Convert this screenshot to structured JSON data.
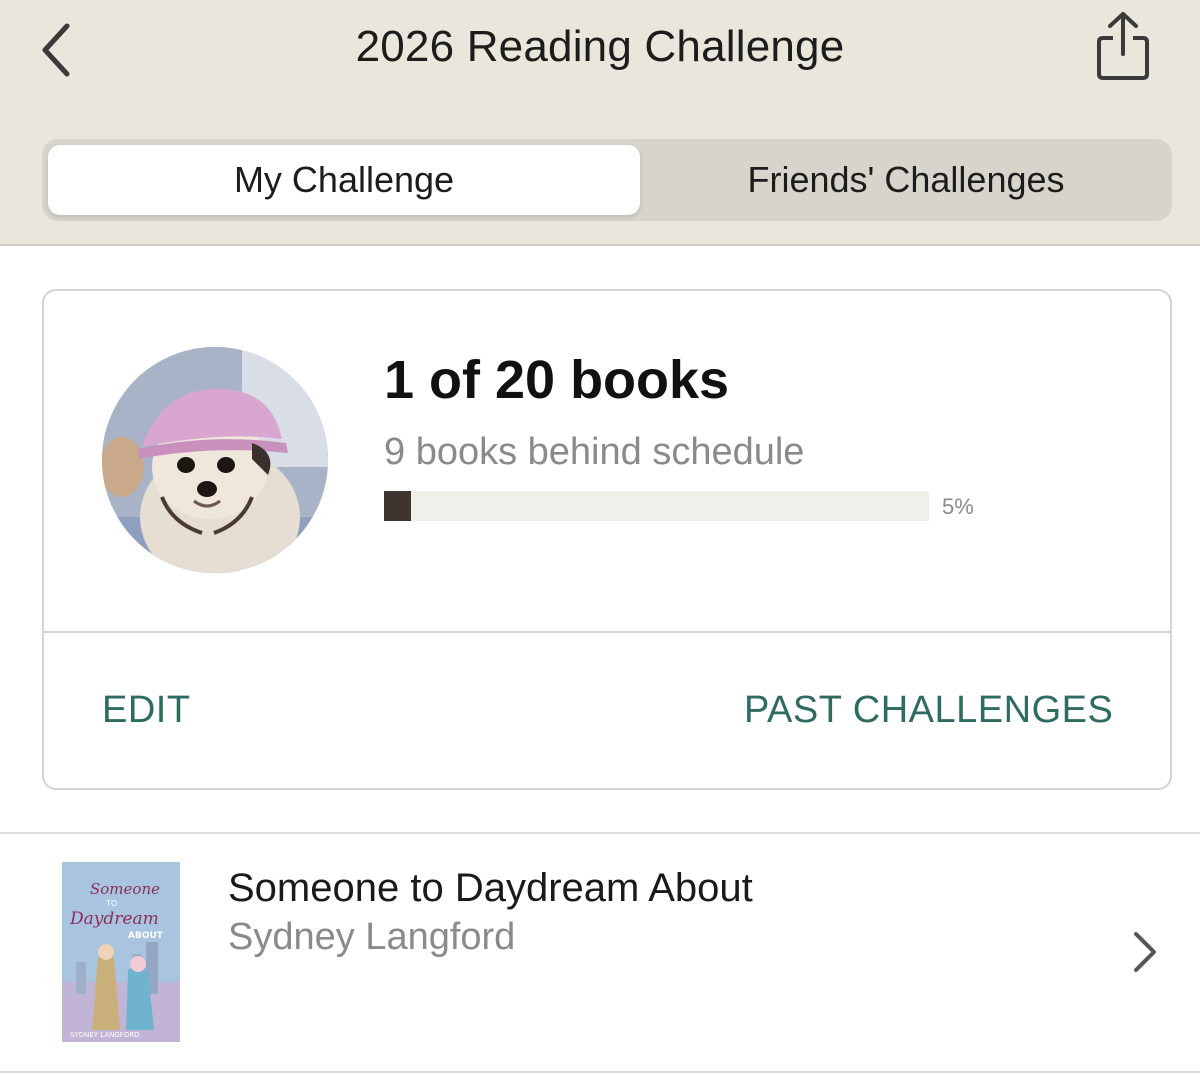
{
  "header": {
    "title": "2026 Reading Challenge",
    "back_icon": "chevron-left-icon",
    "share_icon": "share-icon"
  },
  "tabs": [
    {
      "label": "My Challenge",
      "selected": true
    },
    {
      "label": "Friends' Challenges",
      "selected": false
    }
  ],
  "challenge": {
    "progress_text": "1 of 20 books",
    "status_text": "9 books behind schedule",
    "progress_fraction": 0.05,
    "progress_percent_label": "5%",
    "edit_label": "EDIT",
    "past_label": "PAST CHALLENGES"
  },
  "books": [
    {
      "title": "Someone to Daydream About",
      "author": "Sydney Langford",
      "cover_title_1": "Someone",
      "cover_title_2": "TO",
      "cover_title_3": "Daydream",
      "cover_title_4": "ABOUT",
      "cover_author": "SYDNEY LANGFORD"
    }
  ],
  "colors": {
    "header_bg": "#e9e7dc",
    "accent": "#2e6b60",
    "progress_fill": "#3f3530",
    "muted_text": "#8a8a8a"
  }
}
